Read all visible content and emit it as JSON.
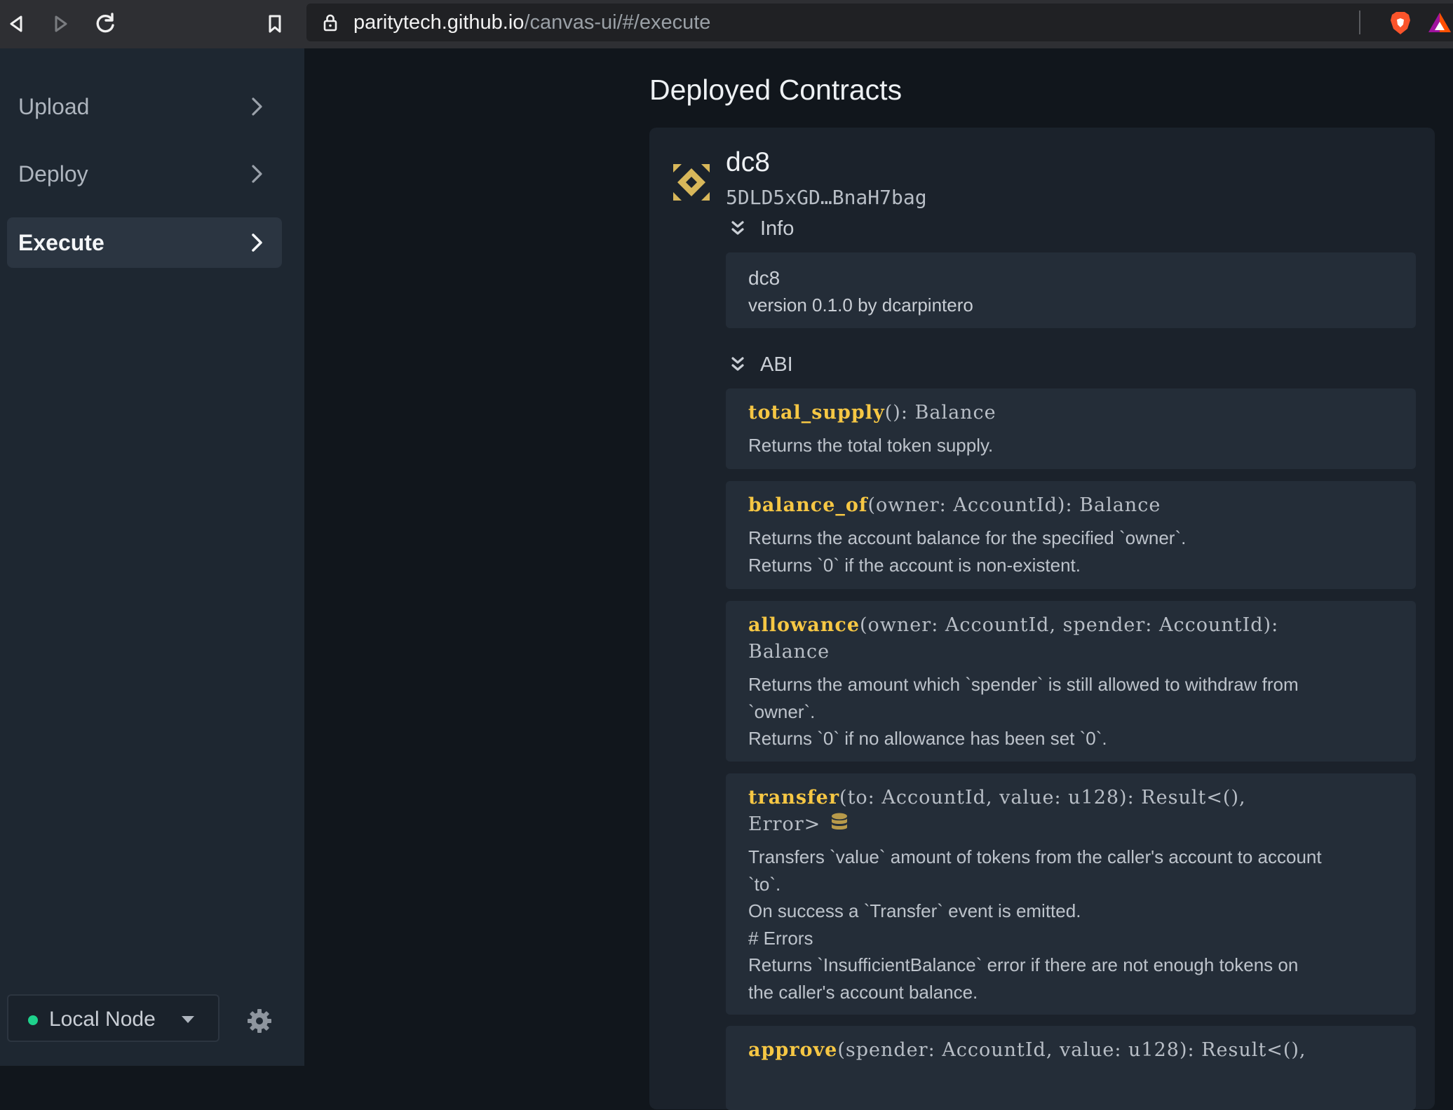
{
  "browser": {
    "url_host": "paritytech.github.io",
    "url_path": "/canvas-ui/#/execute"
  },
  "sidebar": {
    "items": [
      {
        "label": "Upload",
        "active": false
      },
      {
        "label": "Deploy",
        "active": false
      },
      {
        "label": "Execute",
        "active": true
      }
    ],
    "node": {
      "label": "Local Node",
      "status_color": "#1ed28c"
    }
  },
  "main": {
    "title": "Deployed Contracts",
    "contract": {
      "name": "dc8",
      "address": "5DLD5xGD…BnaH7bag",
      "info_toggle": "Info",
      "info": {
        "name": "dc8",
        "version": "version 0.1.0 by dcarpintero"
      },
      "abi_toggle": "ABI",
      "messages": [
        {
          "name": "total_supply",
          "signature": "(): Balance",
          "doc": "Returns the total token supply."
        },
        {
          "name": "balance_of",
          "signature": "(owner: AccountId): Balance",
          "doc": "Returns the account balance for the specified `owner`.\nReturns `0` if the account is non-existent."
        },
        {
          "name": "allowance",
          "signature": "(owner: AccountId, spender: AccountId):\nBalance",
          "doc": "Returns the amount which `spender` is still allowed to withdraw from\n`owner`.\nReturns `0` if no allowance has been set `0`."
        },
        {
          "name": "transfer",
          "signature": "(to: AccountId, value: u128): Result<(),\nError>",
          "mutates": true,
          "doc": "Transfers `value` amount of tokens from the caller's account to account\n`to`.\nOn success a `Transfer` event is emitted.\n# Errors\nReturns `InsufficientBalance` error if there are not enough tokens on\nthe caller's account balance."
        },
        {
          "name": "approve",
          "signature": "(spender: AccountId, value: u128): Result<(),",
          "doc": ""
        }
      ]
    }
  },
  "colors": {
    "accent_function": "#f6c744",
    "active_indicator": "#1ed28c",
    "identicon": "#d8b75a"
  }
}
